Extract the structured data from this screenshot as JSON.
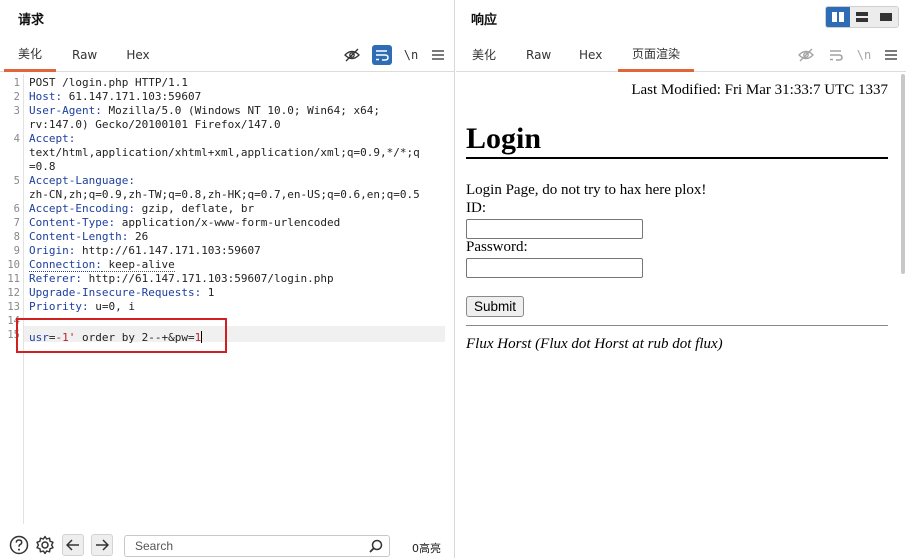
{
  "request": {
    "title": "请求",
    "tabs": [
      "美化",
      "Raw",
      "Hex"
    ],
    "toolbar": {
      "newline_label": "\\n"
    },
    "lines": [
      {
        "n": "1",
        "parts": [
          {
            "t": "POST /login.php HTTP/1.1",
            "c": ""
          }
        ]
      },
      {
        "n": "2",
        "parts": [
          {
            "t": "Host:",
            "c": "hk"
          },
          {
            "t": " 61.147.171.103:59607",
            "c": ""
          }
        ]
      },
      {
        "n": "3",
        "parts": [
          {
            "t": "User-Agent:",
            "c": "hk"
          },
          {
            "t": " Mozilla/5.0 (Windows NT 10.0; Win64; x64;",
            "c": ""
          }
        ]
      },
      {
        "n": "",
        "parts": [
          {
            "t": "rv:147.0) Gecko/20100101 Firefox/147.0",
            "c": ""
          }
        ]
      },
      {
        "n": "4",
        "parts": [
          {
            "t": "Accept:",
            "c": "hk"
          }
        ]
      },
      {
        "n": "",
        "parts": [
          {
            "t": "text/html,application/xhtml+xml,application/xml;q=0.9,*/*;q",
            "c": ""
          }
        ]
      },
      {
        "n": "",
        "parts": [
          {
            "t": "=0.8",
            "c": ""
          }
        ]
      },
      {
        "n": "5",
        "parts": [
          {
            "t": "Accept-Language:",
            "c": "hk"
          }
        ]
      },
      {
        "n": "",
        "parts": [
          {
            "t": "zh-CN,zh;q=0.9,zh-TW;q=0.8,zh-HK;q=0.7,en-US;q=0.6,en;q=0.5",
            "c": ""
          }
        ]
      },
      {
        "n": "6",
        "parts": [
          {
            "t": "Accept-Encoding:",
            "c": "hk"
          },
          {
            "t": " gzip, deflate, br",
            "c": ""
          }
        ]
      },
      {
        "n": "7",
        "parts": [
          {
            "t": "Content-Type:",
            "c": "hk"
          },
          {
            "t": " application/x-www-form-urlencoded",
            "c": ""
          }
        ]
      },
      {
        "n": "8",
        "parts": [
          {
            "t": "Content-Length:",
            "c": "hk"
          },
          {
            "t": " 26",
            "c": ""
          }
        ]
      },
      {
        "n": "9",
        "parts": [
          {
            "t": "Origin:",
            "c": "hk"
          },
          {
            "t": " http://61.147.171.103:59607",
            "c": ""
          }
        ]
      },
      {
        "n": "10",
        "parts": [
          {
            "t": "Connection:",
            "c": "hk dotted"
          },
          {
            "t": " keep-alive",
            "c": "hv dotted"
          }
        ]
      },
      {
        "n": "11",
        "parts": [
          {
            "t": "Referer:",
            "c": "hk"
          },
          {
            "t": " http://61.147.171.103:59607/login.php",
            "c": ""
          }
        ]
      },
      {
        "n": "12",
        "parts": [
          {
            "t": "Upgrade-Insecure-Requests:",
            "c": "hk"
          },
          {
            "t": " 1",
            "c": ""
          }
        ]
      },
      {
        "n": "13",
        "parts": [
          {
            "t": "Priority:",
            "c": "hk"
          },
          {
            "t": " u=0, i",
            "c": ""
          }
        ]
      },
      {
        "n": "14",
        "parts": []
      },
      {
        "n": "15",
        "parts": [
          {
            "t": "usr",
            "c": "v-blue"
          },
          {
            "t": "=",
            "c": ""
          },
          {
            "t": "-1'",
            "c": "v-red"
          },
          {
            "t": " order by 2--+&pw=",
            "c": ""
          },
          {
            "t": "1",
            "c": "v-red"
          }
        ]
      }
    ],
    "search_placeholder": "Search",
    "match_count": "0高亮"
  },
  "response": {
    "title": "响应",
    "tabs": [
      "美化",
      "Raw",
      "Hex",
      "页面渲染"
    ],
    "toolbar": {
      "newline_label": "\\n"
    },
    "page": {
      "last_modified": "Last Modified: Fri Mar 31:33:7 UTC 1337",
      "heading": "Login",
      "intro": "Login Page, do not try to hax here plox!",
      "id_label": "ID:",
      "password_label": "Password:",
      "submit_label": "Submit",
      "footer": "Flux Horst (Flux dot Horst at rub dot flux)"
    }
  },
  "colors": {
    "accent": "#e0663a",
    "toggle_active": "#2e6db5",
    "highlight_border": "#d21f1f"
  }
}
